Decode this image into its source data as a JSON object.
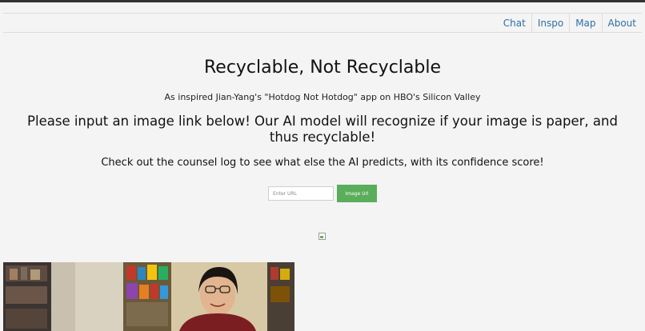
{
  "nav": {
    "items": [
      {
        "label": "Chat"
      },
      {
        "label": "Inspo"
      },
      {
        "label": "Map"
      },
      {
        "label": "About"
      }
    ]
  },
  "main": {
    "title": "Recyclable, Not Recyclable",
    "inspired": "As inspired Jian-Yang's \"Hotdog Not Hotdog\" app on HBO's Silicon Valley",
    "prompt": "Please input an image link below! Our AI model will recognize if your image is paper, and thus recyclable!",
    "counsel": "Check out the counsel log to see what else the AI predicts, with its confidence score!",
    "url_input": {
      "placeholder": "Enter URL",
      "value": ""
    },
    "submit_label": "Image Url"
  },
  "colors": {
    "nav_link": "#2f6fa6",
    "button_bg": "#5aad5a",
    "page_bg": "#f4f4f4"
  }
}
